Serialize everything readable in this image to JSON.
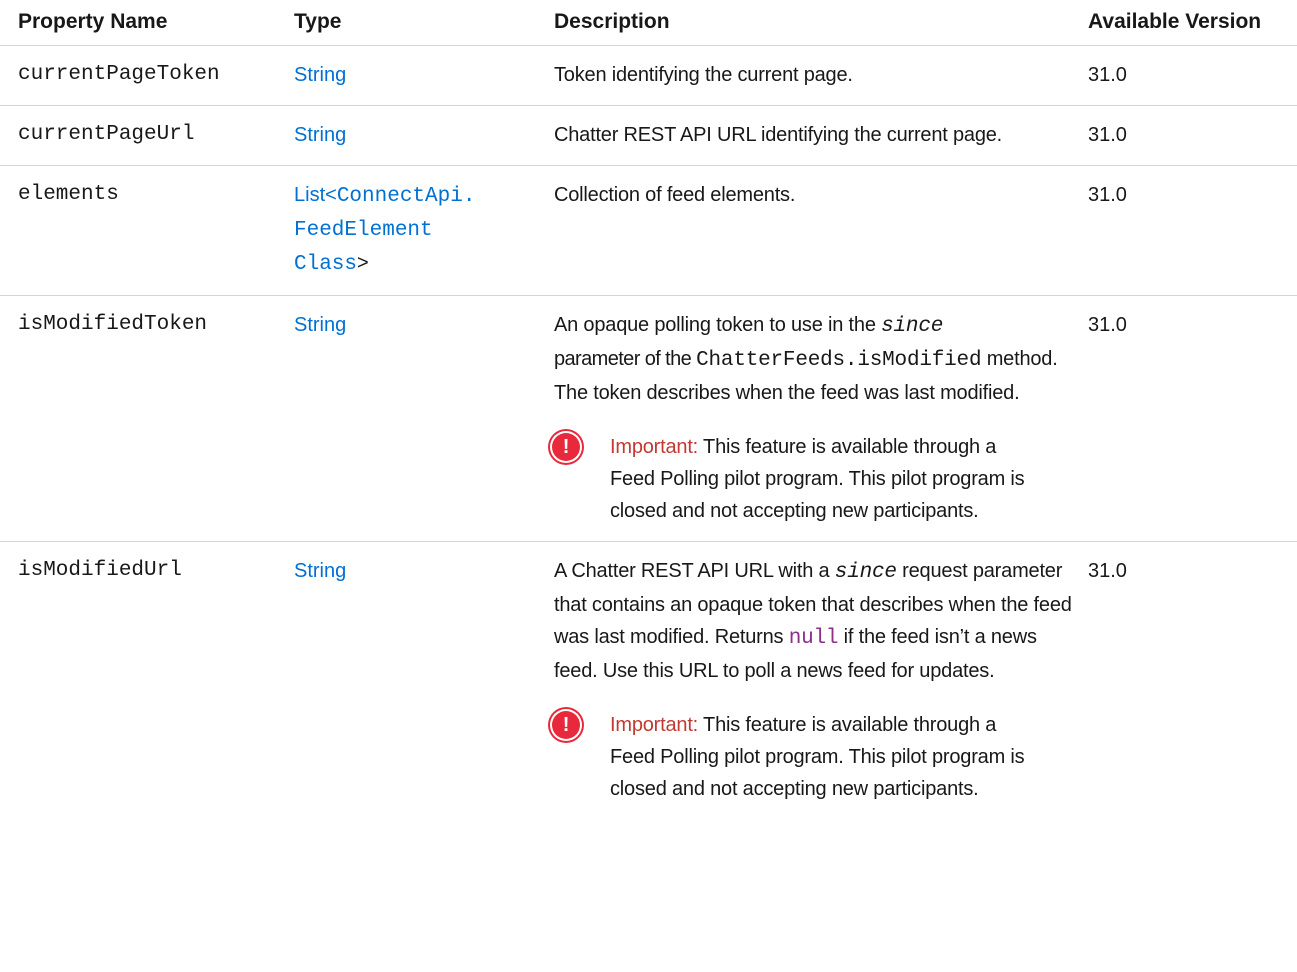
{
  "columns": [
    "Property Name",
    "Type",
    "Description",
    "Available Version"
  ],
  "rows": [
    {
      "name": "currentPageToken",
      "type_link": "String",
      "description": "Token identifying the current page.",
      "version": "31.0"
    },
    {
      "name": "currentPageUrl",
      "type_link": "String",
      "description": "Chatter REST API URL identifying the current page.",
      "version": "31.0"
    },
    {
      "name": "elements",
      "type_prefix": "List<",
      "type_code_1": "ConnectApi.",
      "type_code_2": "FeedElement",
      "type_code_3": "Class",
      "type_suffix": ">",
      "description": "Collection of feed elements.",
      "version": "31.0"
    },
    {
      "name": "isModifiedToken",
      "type_link": "String",
      "desc_1": "An opaque polling token to use in the ",
      "desc_code_italic": "since",
      "desc_2": "parameter of the ",
      "desc_code": "ChatterFeeds.isModified",
      "desc_3": "method. The token describes when the feed was last modified.",
      "note_label": "Important:",
      "note_text": "This feature is available through a Feed Polling pilot program. This pilot program is closed and not accepting new participants.",
      "version": "31.0"
    },
    {
      "name": "isModifiedUrl",
      "type_link": "String",
      "desc_1": "A Chatter REST API URL with a ",
      "desc_code_italic": "since",
      "desc_2": " request parameter that contains an opaque token that describes when the feed was last modified. Returns ",
      "desc_null": "null",
      "desc_3": " if the feed isn’t a news feed. Use this URL to poll a news feed for updates.",
      "note_label": "Important:",
      "note_text": "This feature is available through a Feed Polling pilot program. This pilot program is closed and not accepting new participants.",
      "version": "31.0"
    }
  ],
  "colors": {
    "link": "#0070d2",
    "important_icon": "#e8293b",
    "null_code": "#8b2f8b"
  },
  "icons": [
    "exclamation-circle-icon"
  ]
}
